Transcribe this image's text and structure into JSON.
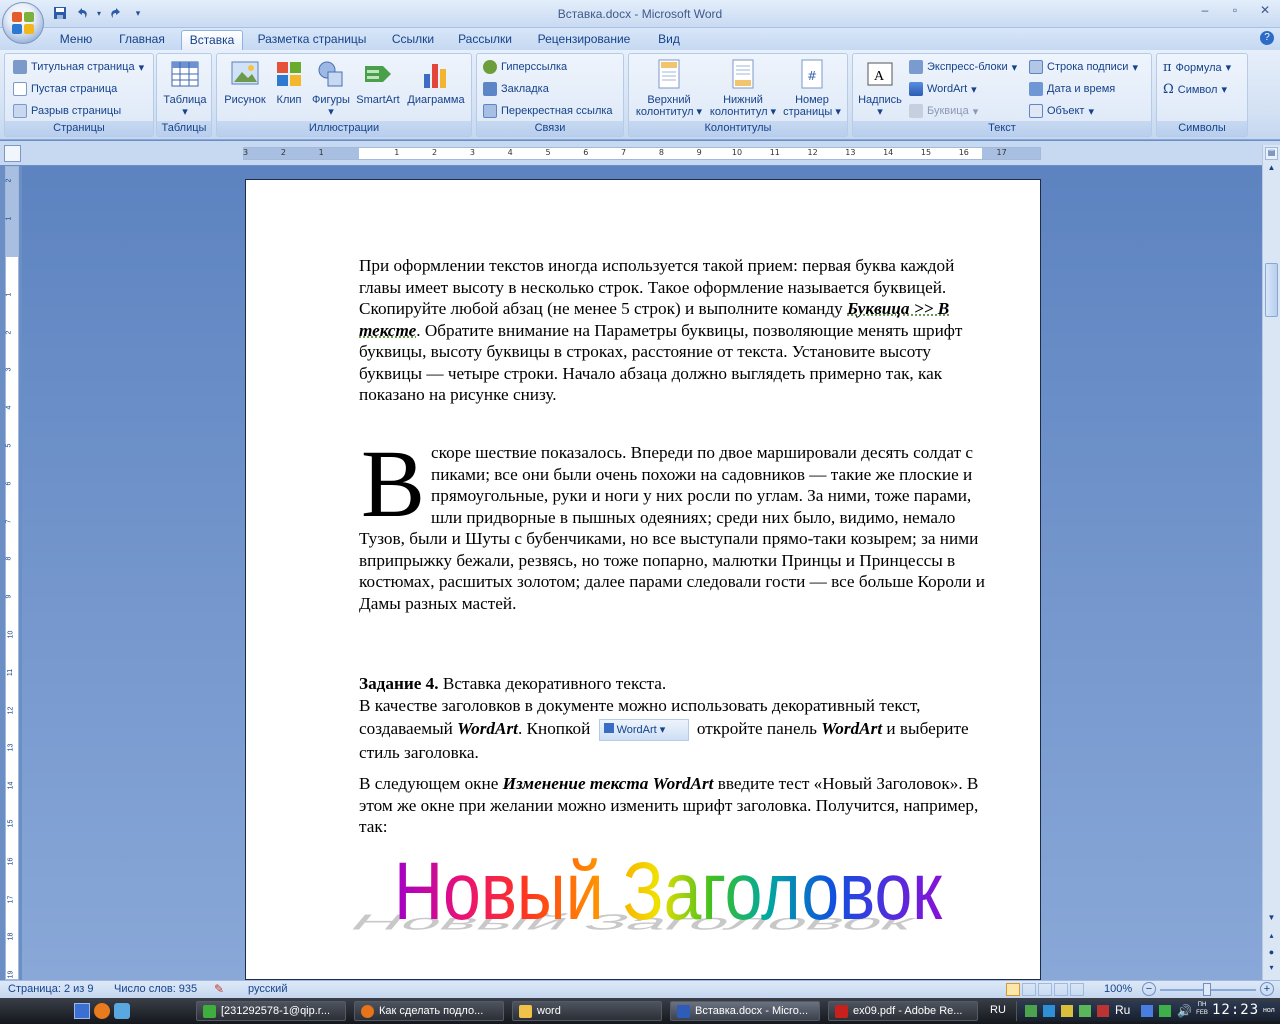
{
  "window": {
    "title": "Вставка.docx - Microsoft Word"
  },
  "qat": {
    "save": "save-icon",
    "undo": "undo-icon",
    "redo": "redo-icon"
  },
  "tabs": [
    "Меню",
    "Главная",
    "Вставка",
    "Разметка страницы",
    "Ссылки",
    "Рассылки",
    "Рецензирование",
    "Вид"
  ],
  "active_tab": "Вставка",
  "ribbon": {
    "pages": {
      "label": "Страницы",
      "items": [
        "Титульная страница",
        "Пустая страница",
        "Разрыв страницы"
      ]
    },
    "tables": {
      "label": "Таблицы",
      "table": "Таблица"
    },
    "illustrations": {
      "label": "Иллюстрации",
      "picture": "Рисунок",
      "clip": "Клип",
      "shapes": "Фигуры",
      "smartart": "SmartArt",
      "chart": "Диаграмма"
    },
    "links": {
      "label": "Связи",
      "items": [
        "Гиперссылка",
        "Закладка",
        "Перекрестная ссылка"
      ]
    },
    "headers": {
      "label": "Колонтитулы",
      "header_1": "Верхний",
      "header_2": "колонтитул",
      "footer_1": "Нижний",
      "footer_2": "колонтитул",
      "pagenum_1": "Номер",
      "pagenum_2": "страницы"
    },
    "text": {
      "label": "Текст",
      "textbox": "Надпись",
      "quickparts": "Экспресс-блоки",
      "wordart": "WordArt",
      "dropcap": "Буквица",
      "signature": "Строка подписи",
      "datetime": "Дата и время",
      "object": "Объект"
    },
    "symbols": {
      "label": "Символы",
      "equation": "Формула",
      "symbol": "Символ"
    }
  },
  "ruler": {
    "h_labels": [
      "3",
      "2",
      "1",
      "1",
      "2",
      "3",
      "4",
      "5",
      "6",
      "7",
      "8",
      "9",
      "10",
      "11",
      "12",
      "13",
      "14",
      "15",
      "16",
      "17"
    ],
    "v_labels": [
      "2",
      "1",
      "1",
      "2",
      "3",
      "4",
      "5",
      "6",
      "7",
      "8",
      "9",
      "10",
      "11",
      "12",
      "13",
      "14",
      "15",
      "16",
      "17",
      "18",
      "19"
    ]
  },
  "document": {
    "para1_a": " При оформлении текстов иногда используется такой прием: первая буква каждой главы имеет высоту в несколько строк. Такое оформление называется буквицей. Скопируйте любой абзац (не менее 5 строк) и выполните команду ",
    "para1_cmd": "Буквица >> В тексте",
    "para1_b": ". Обратите внимание на Параметры буквицы, позволяющие менять шрифт буквицы, высоту буквицы в строках, расстояние от текста.  Установите высоту буквицы — четыре строки. Начало абзаца должно выглядеть примерно так, как показано на рисунке снизу.",
    "dropcap": "В",
    "para2": "скоре шествие показалось. Впереди по двое маршировали десять солдат с пиками; все они были очень похожи на садовников — такие же плоские и прямоугольные, руки и ноги у них росли по углам. За ними, тоже парами, шли придворные в пышных одеяниях; среди них было, видимо, немало Тузов, были и Шуты с бубенчиками, но все выступали прямо-таки козырем; за ними вприпрыжку бежали, резвясь, но тоже попарно, малютки Принцы и Принцессы в костюмах, расшитых золотом; далее парами следовали гости — все больше Короли и Дамы разных мастей.",
    "task_bold": "Задание 4.",
    "task_rest": " Вставка декоративного текста.",
    "p3_a": "В качестве заголовков в документе можно использовать декоративный текст, создаваемый ",
    "p3_wa": "WordArt",
    "p3_b": ". Кнопкой ",
    "p3_btn": "WordArt",
    "p3_c": " откройте панель ",
    "p3_wa2": "WordArt",
    "p3_d": " и выберите стиль заголовка.",
    "p4_a": "В следующем окне ",
    "p4_bi": "Изменение текста WordArt",
    "p4_b": " введите тест  «Новый Заголовок». В этом же окне при желании можно изменить шрифт заголовка. Получится, например, так:",
    "wordart_text": "Новый Заголовок"
  },
  "status": {
    "page": "Страница: 2 из 9",
    "words": "Число слов: 935",
    "lang": "русский",
    "zoom": "100%"
  },
  "taskbar": {
    "items": [
      "[231292578-1@qip.r...",
      "Как сделать подло...",
      "word",
      "Вставка.docx - Micro...",
      "ex09.pdf - Adobe Re..."
    ],
    "lang": "RU",
    "tray_lang": "Ru",
    "clock": "12:23",
    "day": "ПН",
    "month": "FEB",
    "ampm": "нол"
  },
  "colors": {
    "ribbon_text": "#15428b",
    "accent": "#8db2e3"
  }
}
